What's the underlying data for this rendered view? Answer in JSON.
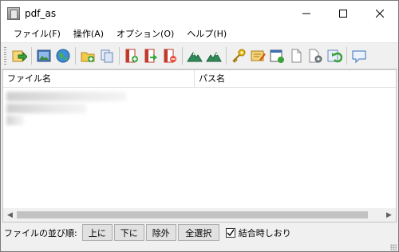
{
  "window": {
    "title": "pdf_as"
  },
  "menu": [
    {
      "label": "ファイル(F)"
    },
    {
      "label": "操作(A)"
    },
    {
      "label": "オプション(O)"
    },
    {
      "label": "ヘルプ(H)"
    }
  ],
  "toolbar": {
    "icons": [
      "open-icon",
      "image-icon",
      "globe-icon",
      "folder-add-icon",
      "copy-files-icon",
      "pdf-add-icon",
      "pdf-arrow-icon",
      "pdf-remove-icon",
      "mountain-icon",
      "mountain-alt-icon",
      "key-icon",
      "edit-icon",
      "window-icon",
      "blank-page-icon",
      "settings-page-icon",
      "refresh-icon",
      "comment-icon"
    ]
  },
  "list": {
    "columns": [
      "ファイル名",
      "パス名"
    ]
  },
  "bottom": {
    "order_label": "ファイルの並び順:",
    "buttons": [
      "上に",
      "下に",
      "除外",
      "全選択"
    ],
    "checkbox_label": "結合時しおり",
    "checkbox_checked": true
  },
  "colors": {
    "accent": "#2e7d32",
    "toolbar_bg": "#f0f0f0"
  }
}
